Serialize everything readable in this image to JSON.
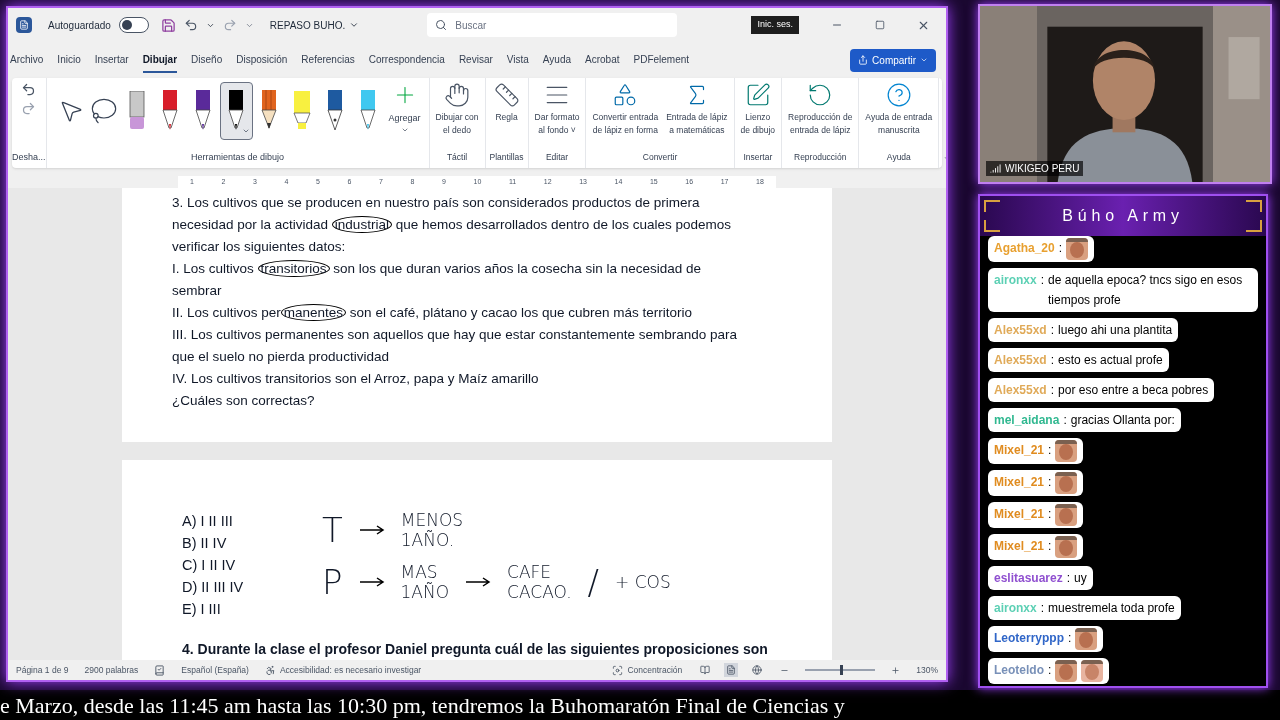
{
  "word": {
    "autosave_label": "Autoguardado",
    "autosave_on": false,
    "doc_title": "REPASO BUHO.",
    "search": {
      "placeholder": "Buscar"
    },
    "signin": "Inic. ses.",
    "tabs": [
      {
        "label": "Archivo",
        "selected": false
      },
      {
        "label": "Inicio",
        "selected": false
      },
      {
        "label": "Insertar",
        "selected": false
      },
      {
        "label": "Dibujar",
        "selected": true
      },
      {
        "label": "Diseño",
        "selected": false
      },
      {
        "label": "Disposición",
        "selected": false
      },
      {
        "label": "Referencias",
        "selected": false
      },
      {
        "label": "Correspondencia",
        "selected": false
      },
      {
        "label": "Revisar",
        "selected": false
      },
      {
        "label": "Vista",
        "selected": false
      },
      {
        "label": "Ayuda",
        "selected": false
      },
      {
        "label": "Acrobat",
        "selected": false
      },
      {
        "label": "PDFelement",
        "selected": false
      }
    ],
    "share": "Compartir",
    "undo_group": "Desha...",
    "draw_group": "Herramientas de dibujo",
    "tools": [
      {
        "kind": "select",
        "selected": false
      },
      {
        "kind": "lasso",
        "selected": false
      },
      {
        "kind": "eraser",
        "color": "#c896d8",
        "selected": false
      },
      {
        "kind": "pen",
        "color": "#d81e2a",
        "selected": false
      },
      {
        "kind": "pen",
        "color": "#5a2a9a",
        "selected": false
      },
      {
        "kind": "pen",
        "color": "#000000",
        "selected": true
      },
      {
        "kind": "pencil",
        "color": "#e0641e",
        "selected": false
      },
      {
        "kind": "highlighter",
        "color": "#f8f040",
        "selected": false
      },
      {
        "kind": "fountain",
        "color": "#1e5aa0",
        "selected": false
      },
      {
        "kind": "pen",
        "color": "#40c8f0",
        "selected": false
      }
    ],
    "add_label": "Agregar",
    "groups": [
      {
        "label": "Táctil",
        "buttons": [
          {
            "kind": "finger",
            "label": "Dibujar con\nel dedo"
          }
        ]
      },
      {
        "label": "Plantillas",
        "buttons": [
          {
            "kind": "ruler",
            "label": "Regla"
          }
        ]
      },
      {
        "label": "Editar",
        "buttons": [
          {
            "kind": "background",
            "label": "Dar formato\nal fondo ˅"
          }
        ]
      },
      {
        "label": "Convertir",
        "buttons": [
          {
            "kind": "shape",
            "label": "Convertir entrada\nde lápiz en forma"
          },
          {
            "kind": "math",
            "label": "Entrada de lápiz\na matemáticas"
          }
        ]
      },
      {
        "label": "Insertar",
        "buttons": [
          {
            "kind": "canvas",
            "label": "Lienzo\nde dibujo"
          }
        ]
      },
      {
        "label": "Reproducción",
        "buttons": [
          {
            "kind": "replay",
            "label": "Reproducción de\nentrada de lápiz"
          }
        ]
      },
      {
        "label": "Ayuda",
        "buttons": [
          {
            "kind": "help",
            "label": "Ayuda de entrada\nmanuscrita"
          }
        ]
      }
    ],
    "ruler_marks": [
      "1",
      "2",
      "3",
      "4",
      "5",
      "6",
      "7",
      "8",
      "9",
      "10",
      "11",
      "12",
      "13",
      "14",
      "15",
      "16",
      "17",
      "18"
    ],
    "question_lines": [
      {
        "before": "3. Los cultivos que se producen en nuestro país son considerados productos de primera"
      },
      {
        "before": "necesidad por la actividad ",
        "circled": "industrial",
        "after": " que hemos desarrollados dentro de los cuales podemos"
      },
      {
        "before": "verificar los siguientes datos:"
      },
      {
        "before": "I. Los cultivos ",
        "circled": "transitorios",
        "after": " son los que duran varios años la cosecha sin la necesidad de"
      },
      {
        "before": "sembrar"
      },
      {
        "before": "II. Los cultivos per",
        "circled": "manentes",
        "after": " son el café, plátano y cacao los que cubren más territorio"
      },
      {
        "before": "III. Los cultivos permanentes son aquellos que hay que estar constantemente sembrando para"
      },
      {
        "before": "que el suelo no pierda productividad"
      },
      {
        "before": "IV. Los cultivos transitorios son el Arroz, papa y Maíz amarillo"
      },
      {
        "before": "¿Cuáles son correctas?"
      }
    ],
    "options": [
      "A) I II III",
      "B) II IV",
      "C) I II IV",
      "D) II III IV",
      "E) I III"
    ],
    "ink_rows": [
      [
        {
          "kind": "letter",
          "text": "T"
        },
        {
          "kind": "arrow"
        },
        {
          "kind": "note",
          "text": "MENOS\n1AÑO."
        }
      ],
      [
        {
          "kind": "letter",
          "text": "P"
        },
        {
          "kind": "arrow"
        },
        {
          "kind": "note",
          "text": "MAS\n1AÑO"
        },
        {
          "kind": "arrow"
        },
        {
          "kind": "note",
          "text": "CAFE\nCACAO."
        },
        {
          "kind": "letter",
          "text": "/"
        },
        {
          "kind": "note",
          "text": "+ COS"
        }
      ]
    ],
    "next_question": "4. Durante la clase el profesor Daniel pregunta cuál de las siguientes proposiciones son",
    "status": {
      "page": "Página 1 de 9",
      "words": "2900 palabras",
      "language": "Español (España)",
      "accessibility": "Accesibilidad: es necesario investigar",
      "focus": "Concentración",
      "views": [
        {
          "selected": false
        },
        {
          "selected": true
        },
        {
          "selected": false
        }
      ],
      "zoom": {
        "level": 0.5,
        "text": "130%"
      }
    }
  },
  "webcam": {
    "label": "WIKIGEO PERU"
  },
  "chat": {
    "title": "Búho Army",
    "messages": [
      {
        "user": "Agatha_20",
        "color": "#e8a030",
        "separator": ":"
      },
      {
        "user": "aironxx",
        "color": "#5cd0b4",
        "separator": ":",
        "text": "de aquella epoca? tncs sigo en esos tiempos profe"
      },
      {
        "user": "Alex55xd",
        "color": "#e0aa58",
        "separator": ":",
        "text": "luego ahi una plantita"
      },
      {
        "user": "Alex55xd",
        "color": "#e0aa58",
        "separator": ":",
        "text": "esto es actual profe"
      },
      {
        "user": "Alex55xd",
        "color": "#e0aa58",
        "separator": ":",
        "text": "por eso entre a beca pobres"
      },
      {
        "user": "mel_aidana",
        "color": "#30b890",
        "separator": ":",
        "text": "gracias Ollanta por:"
      },
      {
        "user": "Mixel_21",
        "color": "#e08c20",
        "separator": ":"
      },
      {
        "user": "Mixel_21",
        "color": "#e08c20",
        "separator": ":"
      },
      {
        "user": "Mixel_21",
        "color": "#e08c20",
        "separator": ":"
      },
      {
        "user": "Mixel_21",
        "color": "#e08c20",
        "separator": ":"
      },
      {
        "user": "eslitasuarez",
        "color": "#9050d0",
        "separator": ":",
        "text": "uy"
      },
      {
        "user": "aironxx",
        "color": "#5cd0b4",
        "separator": ":",
        "text": "muestremela toda profe"
      },
      {
        "user": "Leoterryppp",
        "color": "#3066c8",
        "separator": ":"
      },
      {
        "user": "Leoteldo",
        "color": "#7890b8",
        "separator": ":"
      }
    ]
  },
  "ticker": "e Marzo, desde las 11:45 am hasta las 10:30 pm, tendremos la Buhomaratón Final de Ciencias y"
}
